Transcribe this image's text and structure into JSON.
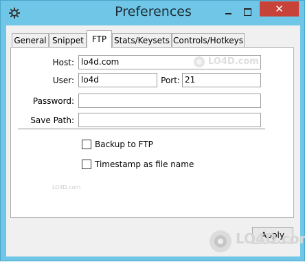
{
  "window": {
    "title": "Preferences",
    "close_symbol": "✕",
    "icons": {
      "app": "gear-icon",
      "minimize": "minimize-icon",
      "maximize": "maximize-icon",
      "close": "close-icon"
    }
  },
  "tabs": [
    {
      "label": "General",
      "active": false
    },
    {
      "label": "Snippet",
      "active": false
    },
    {
      "label": "FTP",
      "active": true
    },
    {
      "label": "Stats/Keysets",
      "active": false
    },
    {
      "label": "Controls/Hotkeys",
      "active": false
    }
  ],
  "ftp": {
    "host_label": "Host:",
    "host_value": "lo4d.com",
    "user_label": "User:",
    "user_value": "lo4d",
    "port_label": "Port:",
    "port_value": "21",
    "password_label": "Password:",
    "password_value": "",
    "save_path_label": "Save Path:",
    "save_path_value": "",
    "backup_label": "Backup to FTP",
    "backup_checked": false,
    "timestamp_label": "Timestamp as file name",
    "timestamp_checked": false
  },
  "apply_label": "Apply",
  "watermark": {
    "text": "LO4D.com",
    "small_text": "LO4D.com"
  },
  "colors": {
    "titlebar": "#6fc6e6",
    "close_button": "#c7433a",
    "panel": "#ffffff",
    "client": "#f0f0f0"
  }
}
